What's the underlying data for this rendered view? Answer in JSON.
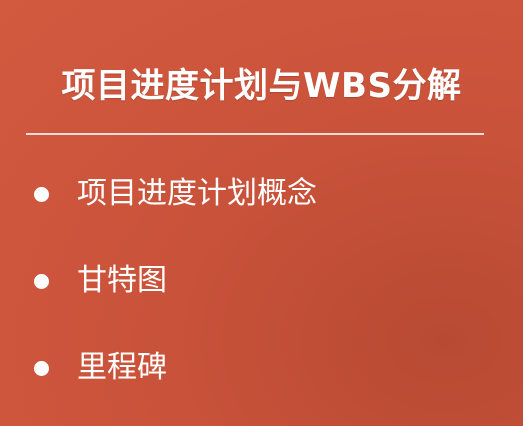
{
  "slide": {
    "title": "项目进度计划与WBS分解",
    "bullets": [
      {
        "label": "项目进度计划概念"
      },
      {
        "label": "甘特图"
      },
      {
        "label": "里程碑"
      }
    ]
  },
  "colors": {
    "background": "#cc5439",
    "text": "#ffffff",
    "divider": "#f3ddd6"
  }
}
